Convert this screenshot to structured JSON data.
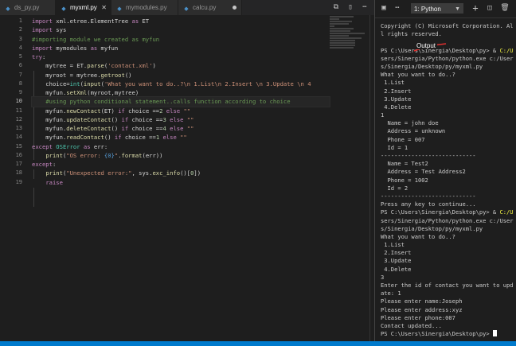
{
  "tabs": [
    {
      "label": "ds_py.py",
      "active": false,
      "dirty": false
    },
    {
      "label": "myxml.py",
      "active": true,
      "dirty": false
    },
    {
      "label": "mymodules.py",
      "active": false,
      "dirty": false
    },
    {
      "label": "calcu.py",
      "active": false,
      "dirty": true
    }
  ],
  "editor": {
    "line_numbers": [
      "1",
      "2",
      "3",
      "4",
      "5",
      "6",
      "7",
      "8",
      "9",
      "10",
      "11",
      "12",
      "13",
      "14",
      "15",
      "16",
      "17",
      "18",
      "19"
    ],
    "current_line": 10
  },
  "panel": {
    "terminal_select": "1: Python",
    "annotation": "Output"
  },
  "terminal_lines": [
    "Copyright (C) Microsoft Corporation. Al",
    "l rights reserved.",
    "",
    "PS C:\\Users\\Sinergia\\Desktop\\py> & C:/U",
    "sers/Sinergia/Python/python.exe c:/User",
    "s/Sinergia/Desktop/py/myxml.py",
    "What you want to do..?",
    " 1.List",
    " 2.Insert",
    " 3.Update",
    " 4.Delete",
    "1",
    "  Name = john doe",
    "  Address = unknown",
    "  Phone = 007",
    "  Id = 1",
    "----------------------------",
    "  Name = Test2",
    "  Address = Test Address2",
    "  Phone = 1002",
    "  Id = 2",
    "----------------------------",
    "Press any key to continue...",
    "PS C:\\Users\\Sinergia\\Desktop\\py> & C:/U",
    "sers/Sinergia/Python/python.exe c:/User",
    "s/Sinergia/Desktop/py/myxml.py",
    "What you want to do..?",
    " 1.List",
    " 2.Insert",
    " 3.Update",
    " 4.Delete",
    "3",
    "Enter the id of contact you want to upd",
    "ate: 1",
    "Please enter name:Joseph",
    "Please enter address:xyz",
    "Please enter phone:007",
    "Contact updated...",
    "PS C:\\Users\\Sinergia\\Desktop\\py> "
  ],
  "colors": {
    "accent": "#007acc",
    "background": "#1e1e1e"
  }
}
